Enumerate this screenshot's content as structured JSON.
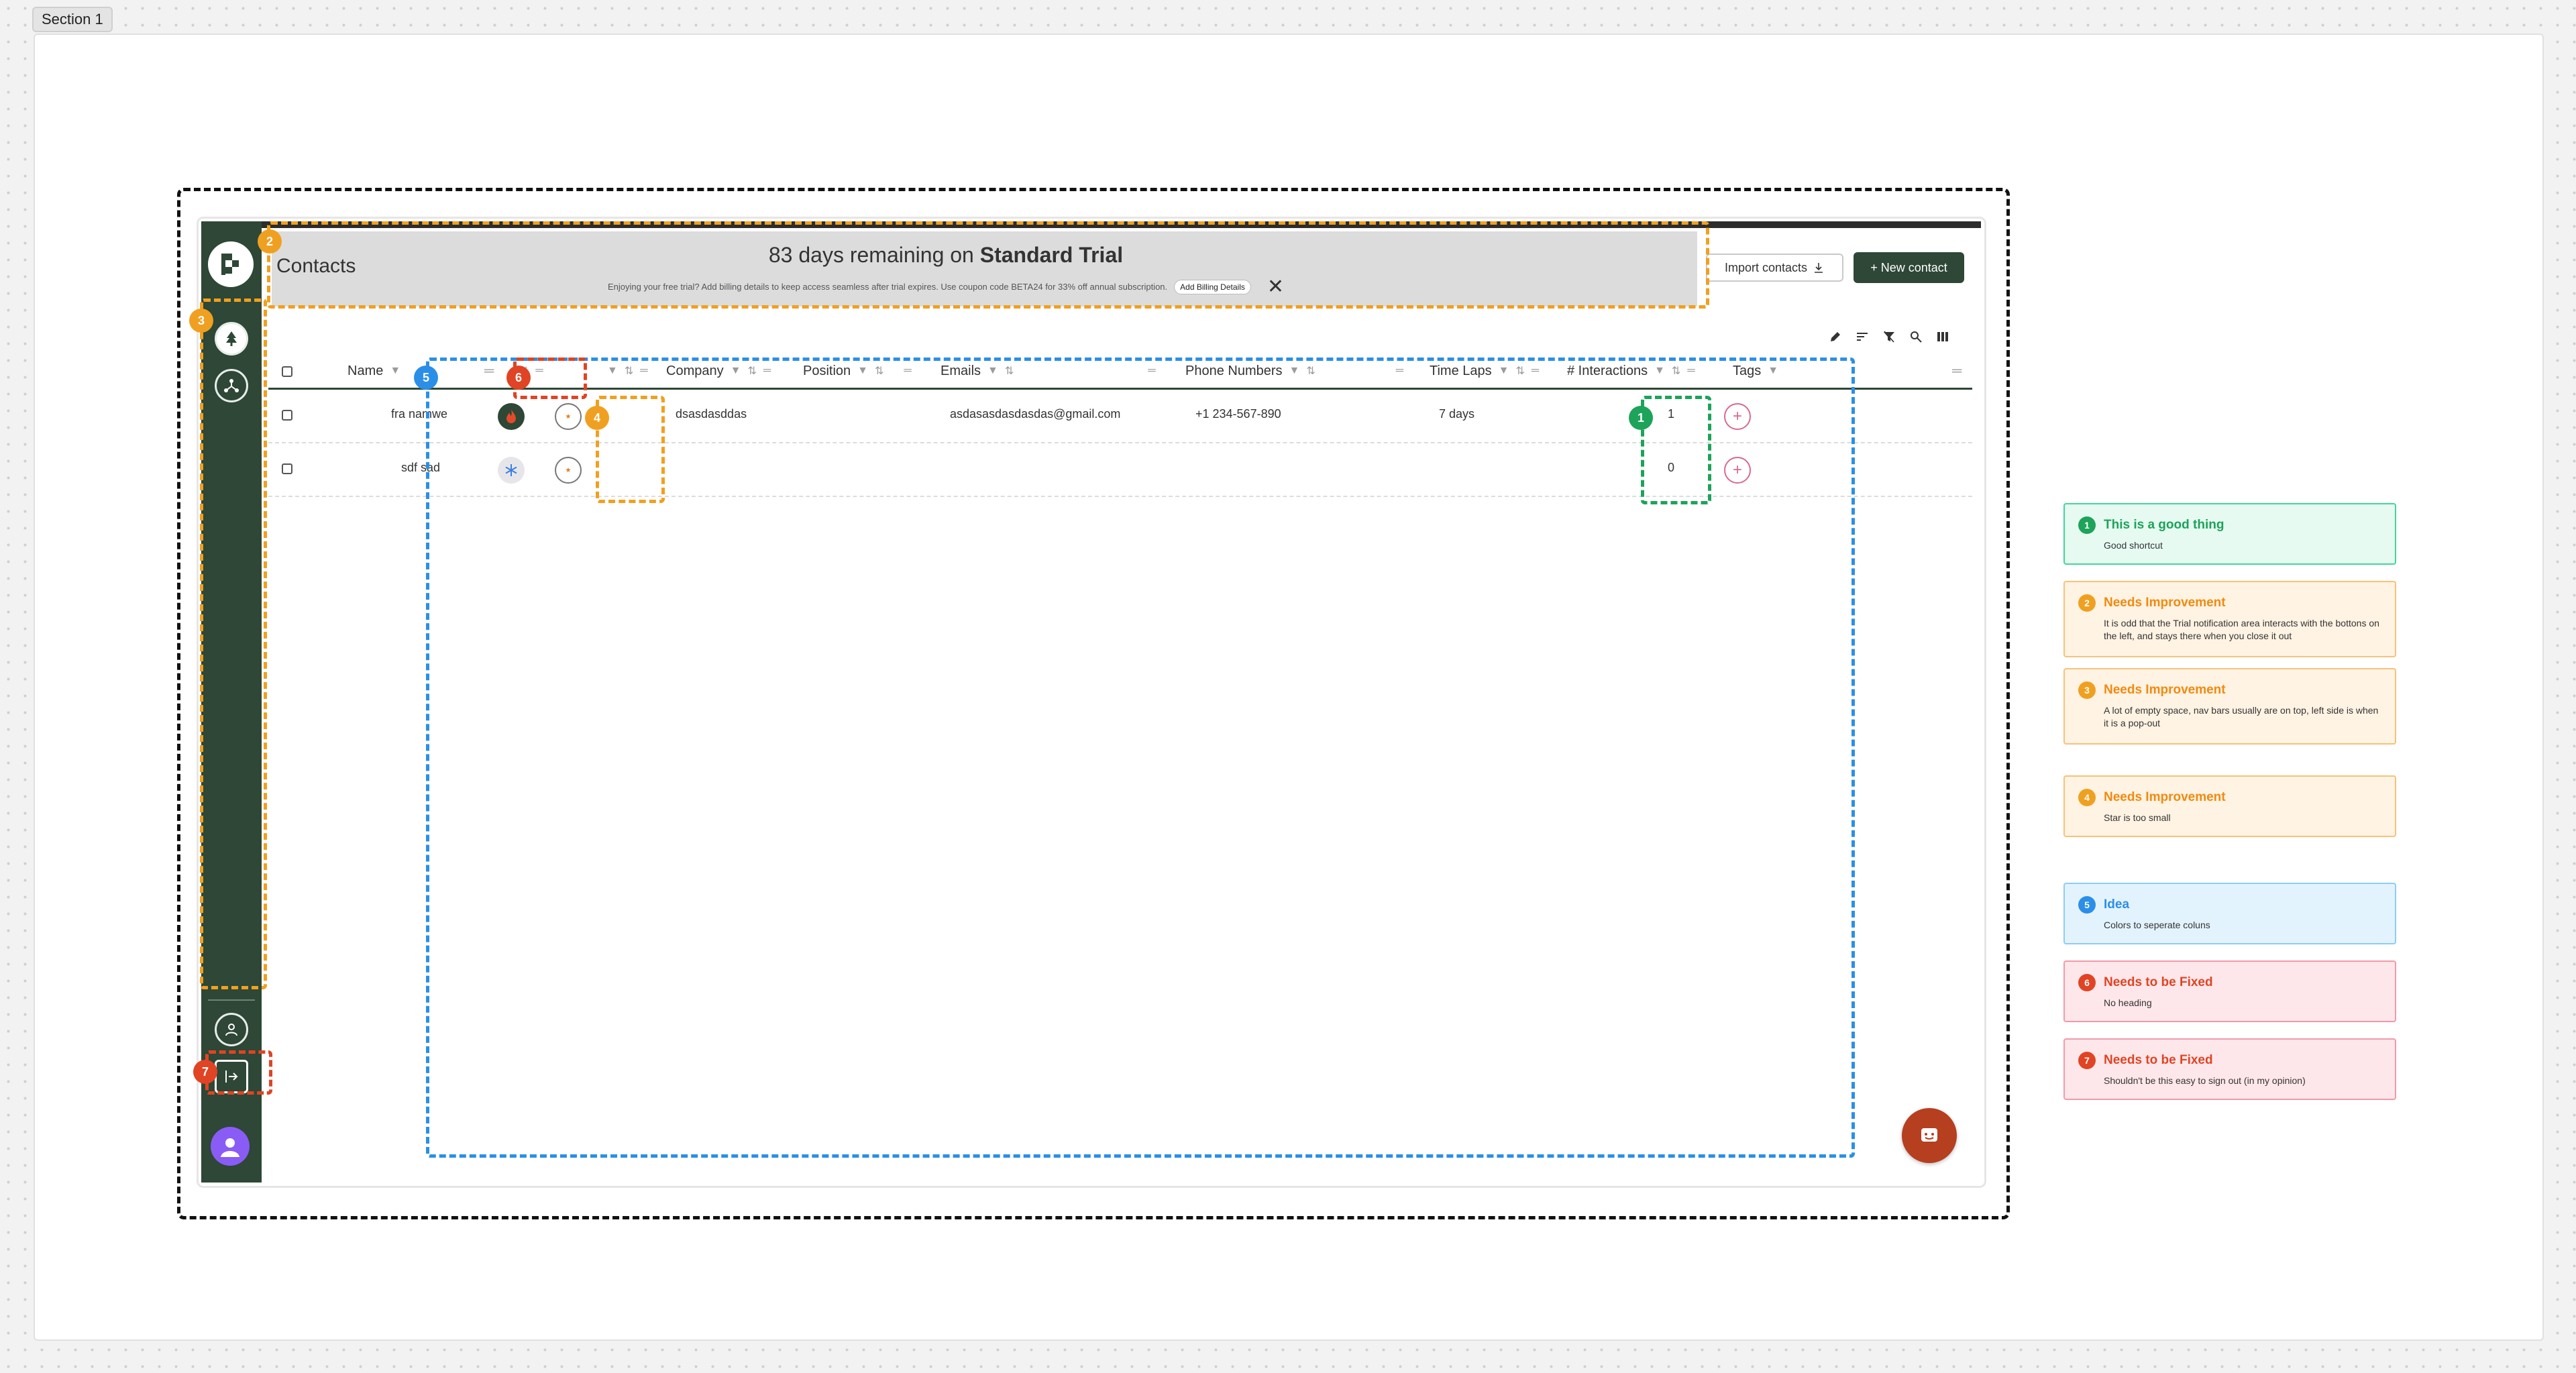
{
  "canvas": {
    "section_label": "Section 1"
  },
  "colors": {
    "sidebar": "#2e4736",
    "primary": "#2e4736",
    "orange": "#f0a020",
    "blue": "#2b8fe8",
    "green": "#1da35a",
    "red": "#e04424",
    "fab": "#b53f1f"
  },
  "app": {
    "page_title": "Contacts",
    "trial": {
      "headline_prefix": "83 days remaining on",
      "plan_name": "Standard Trial",
      "subtext": "Enjoying your free trial? Add billing details to keep access seamless after trial expires. Use coupon code BETA24 for 33% off annual subscription.",
      "billing_button": "Add Billing Details",
      "close_icon": "x-icon"
    },
    "buttons": {
      "import": "Import contacts",
      "new_contact": "+ New contact"
    },
    "sidebar": {
      "logo_icon": "flag-logo-icon",
      "items": [
        "tree-icon",
        "network-icon"
      ],
      "bottom_items": [
        "user-icon",
        "sign-out-icon"
      ],
      "avatar_icon": "avatar-icon"
    },
    "toolbar_icons": [
      "pencil-icon",
      "sort-icon",
      "filter-clear-icon",
      "search-icon",
      "columns-icon"
    ],
    "table": {
      "columns": [
        "Name",
        "Company",
        "Position",
        "Emails",
        "Phone Numbers",
        "Time Laps",
        "# Interactions",
        "Tags"
      ],
      "rows": [
        {
          "name": "fra namwe",
          "status": "flame",
          "company": "dsasdasddas",
          "position": "",
          "email": "asdasasdasdasdas@gmail.com",
          "phone": "+1 234-567-890",
          "time": "7 days",
          "interactions": "1"
        },
        {
          "name": "sdf sad",
          "status": "snowflake",
          "company": "",
          "position": "",
          "email": "",
          "phone": "",
          "time": "",
          "interactions": "0"
        }
      ]
    }
  },
  "annotations": {
    "markers": [
      "1",
      "2",
      "3",
      "4",
      "5",
      "6",
      "7"
    ]
  },
  "notes": [
    {
      "num": "1",
      "title": "This is a good thing",
      "body": "Good shortcut",
      "color": "#1da35a",
      "bg": "#e6faf2"
    },
    {
      "num": "2",
      "title": "Needs Improvement",
      "body": "It is odd that the Trial notification area interacts with the bottons on the left, and stays there when you close it out",
      "color": "#f0a020",
      "bg": "#fff3e3"
    },
    {
      "num": "3",
      "title": "Needs Improvement",
      "body": "A lot of empty space, nav bars usually are on top, left side is when it is a pop-out",
      "color": "#f0a020",
      "bg": "#fff3e3"
    },
    {
      "num": "4",
      "title": "Needs Improvement",
      "body": "Star is too small",
      "color": "#f0a020",
      "bg": "#fff3e3"
    },
    {
      "num": "5",
      "title": "Idea",
      "body": "Colors to seperate coluns",
      "color": "#2b8fe8",
      "bg": "#e3f3fd"
    },
    {
      "num": "6",
      "title": "Needs to be Fixed",
      "body": "No heading",
      "color": "#e04424",
      "bg": "#fde7ea"
    },
    {
      "num": "7",
      "title": "Needs to be Fixed",
      "body": "Shouldn't be this easy to sign out (in my opinion)",
      "color": "#e04424",
      "bg": "#fde7ea"
    }
  ]
}
